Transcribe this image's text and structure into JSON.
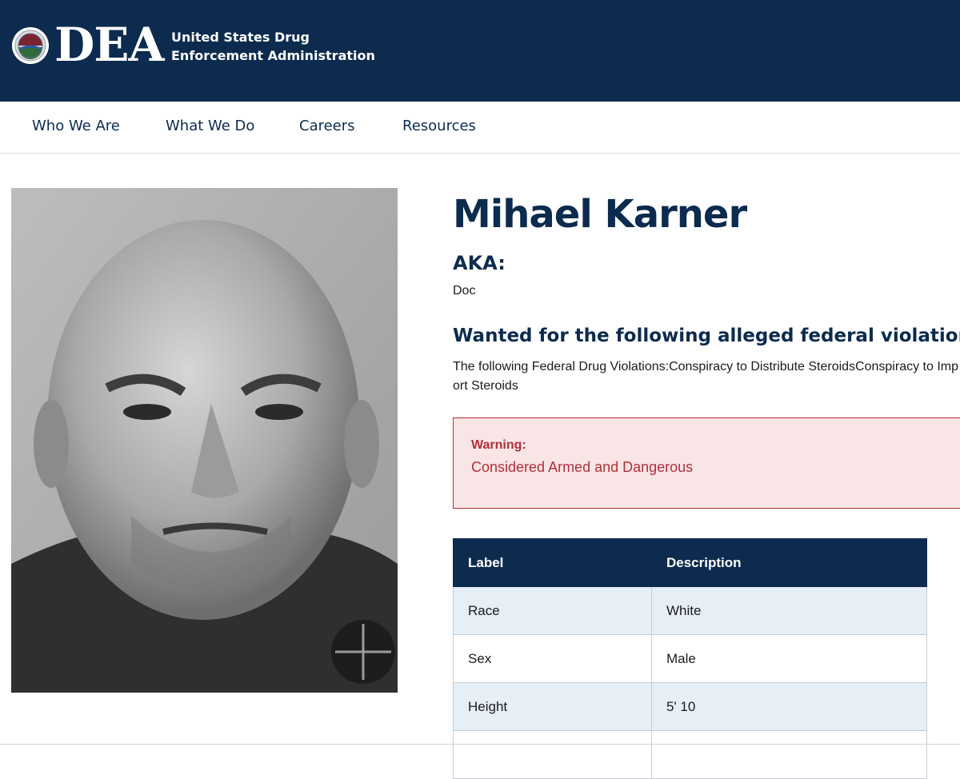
{
  "header": {
    "logo_text": "DEA",
    "agency_name": "United States Drug Enforcement Administration",
    "seal_icon": "dea-seal-icon",
    "background_color": "#0c2b4e"
  },
  "nav": {
    "items": [
      {
        "label": "Who We Are"
      },
      {
        "label": "What We Do"
      },
      {
        "label": "Careers"
      },
      {
        "label": "Resources"
      }
    ]
  },
  "fugitive": {
    "name": "Mihael Karner",
    "aka_label": "AKA:",
    "aka_value": "Doc",
    "violations_heading": "Wanted for the following alleged federal violations",
    "violations_text": "The following Federal Drug Violations:Conspiracy to Distribute SteroidsConspiracy to Import Steroids"
  },
  "warning": {
    "label": "Warning:",
    "text": "Considered Armed and Dangerous",
    "color": "#b0313a"
  },
  "details_table": {
    "headers": [
      "Label",
      "Description"
    ],
    "rows": [
      [
        "Race",
        "White"
      ],
      [
        "Sex",
        "Male"
      ],
      [
        "Height",
        "5' 10"
      ],
      [
        "",
        ""
      ]
    ]
  }
}
